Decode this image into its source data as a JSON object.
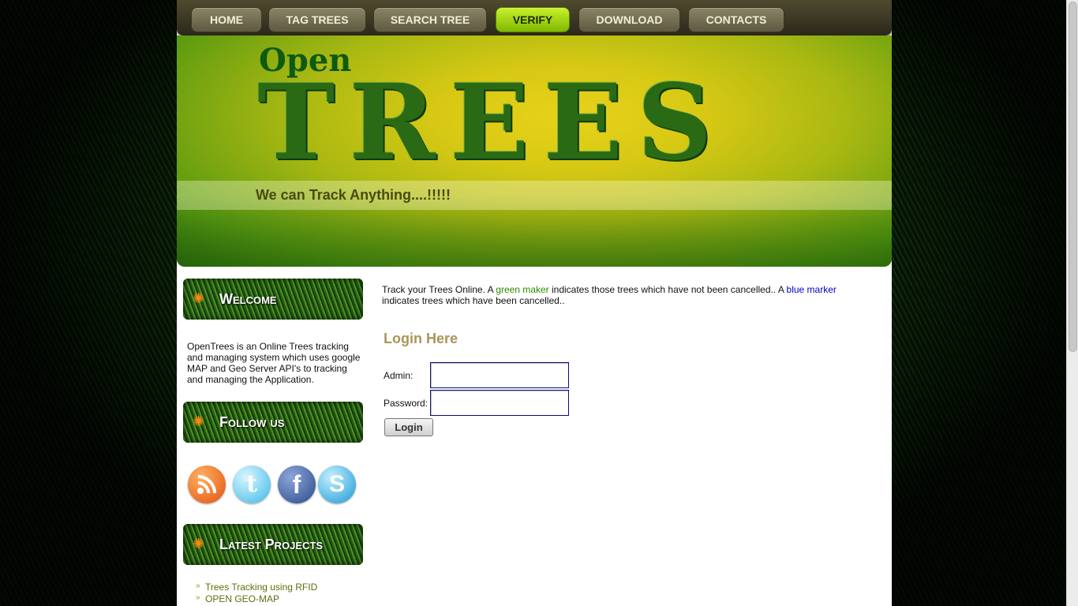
{
  "nav": {
    "items": [
      {
        "label": "HOME"
      },
      {
        "label": "TAG TREES"
      },
      {
        "label": "SEARCH TREE"
      },
      {
        "label": "VERIFY"
      },
      {
        "label": "DOWNLOAD"
      },
      {
        "label": "CONTACTS"
      }
    ],
    "active_item": "VERIFY",
    "active_color": "#9ad80a"
  },
  "banner": {
    "logo_top": "Open",
    "logo_main": "TREES",
    "tagline": "We can Track Anything....!!!!!"
  },
  "sidebar": {
    "welcome_heading": "Welcome",
    "welcome_text": "OpenTrees is an Online Trees tracking and managing system which uses google MAP and Geo Server API's to tracking and managing the Application.",
    "follow_heading": "Follow us",
    "social_icons": [
      "rss-icon",
      "twitter-icon",
      "facebook-icon",
      "skype-icon"
    ],
    "projects_heading": "Latest Projects",
    "projects": [
      "Trees Tracking using RFID",
      "OPEN GEO-MAP"
    ]
  },
  "main": {
    "intro_part1": "Track your Trees Online. A ",
    "green_marker": "green maker",
    "intro_part2": " indicates those trees which have not been cancelled.. A ",
    "blue_marker": "blue marker",
    "intro_part3": " indicates trees which have been cancelled..",
    "login_title": "Login Here",
    "admin_label": "Admin:",
    "password_label": "Password:",
    "admin_value": "",
    "password_value": "",
    "login_button": "Login"
  }
}
